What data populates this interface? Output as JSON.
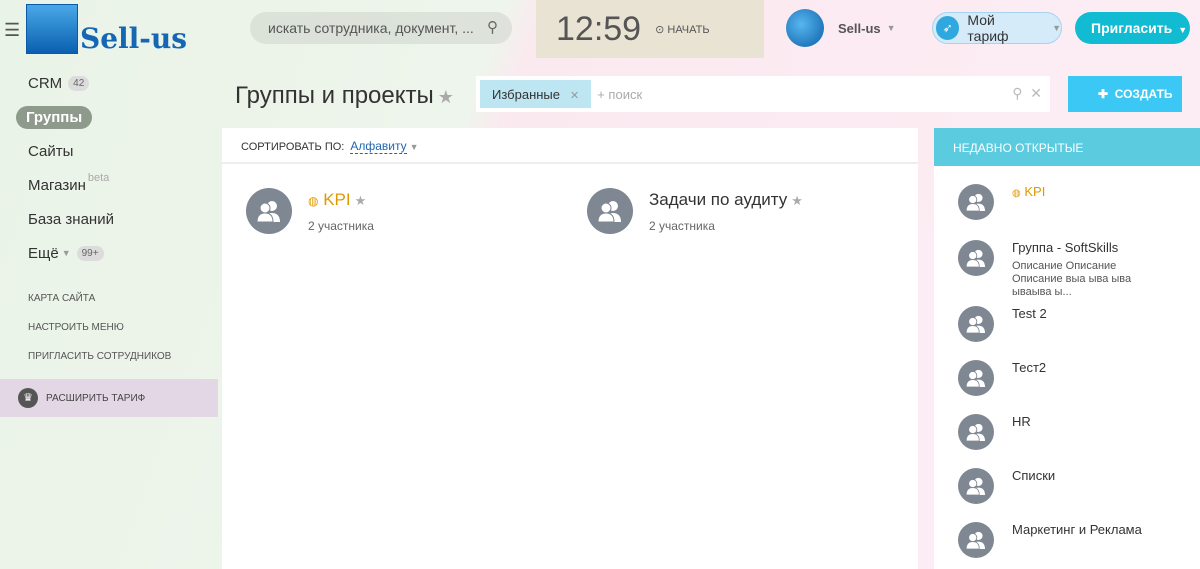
{
  "header": {
    "logo": "Sell-us",
    "search_placeholder": "искать сотрудника, документ, ...",
    "clock": "12:59",
    "start_label": "НАЧАТЬ",
    "account": "Sell-us",
    "tariff": "Мой тариф",
    "invite": "Пригласить"
  },
  "menu": {
    "items": [
      {
        "label": "CRM",
        "badge": "42"
      },
      {
        "label": "Группы"
      },
      {
        "label": "Сайты"
      },
      {
        "label": "Магазин",
        "sup": "beta"
      },
      {
        "label": "База знаний"
      },
      {
        "label": "Ещё",
        "badge": "99+"
      }
    ],
    "links": [
      "КАРТА САЙТА",
      "НАСТРОИТЬ МЕНЮ",
      "ПРИГЛАСИТЬ СОТРУДНИКОВ"
    ],
    "upgrade": "РАСШИРИТЬ ТАРИФ"
  },
  "page": {
    "title": "Группы и проекты",
    "filter_chip": "Избранные",
    "filter_placeholder": "+ поиск",
    "create": "СОЗДАТЬ",
    "sort_label": "СОРТИРОВАТЬ ПО:",
    "sort_value": "Алфавиту"
  },
  "groups": [
    {
      "name": "KPI",
      "members": "2 участника"
    },
    {
      "name": "Задачи по аудиту",
      "members": "2 участника"
    }
  ],
  "recent": {
    "title": "НЕДАВНО ОТКРЫТЫЕ",
    "items": [
      {
        "name": "KPI"
      },
      {
        "name": "Группа - SoftSkills",
        "desc": "Описание Описание Описание выа ыва ыва ываыва ы..."
      },
      {
        "name": "Test 2"
      },
      {
        "name": "Тест2"
      },
      {
        "name": "HR"
      },
      {
        "name": "Списки"
      },
      {
        "name": "Маркетинг и Реклама"
      }
    ]
  },
  "colors": {
    "accent": "#11bcd3",
    "create": "#3bc8f5",
    "orange": "#e09a00"
  }
}
